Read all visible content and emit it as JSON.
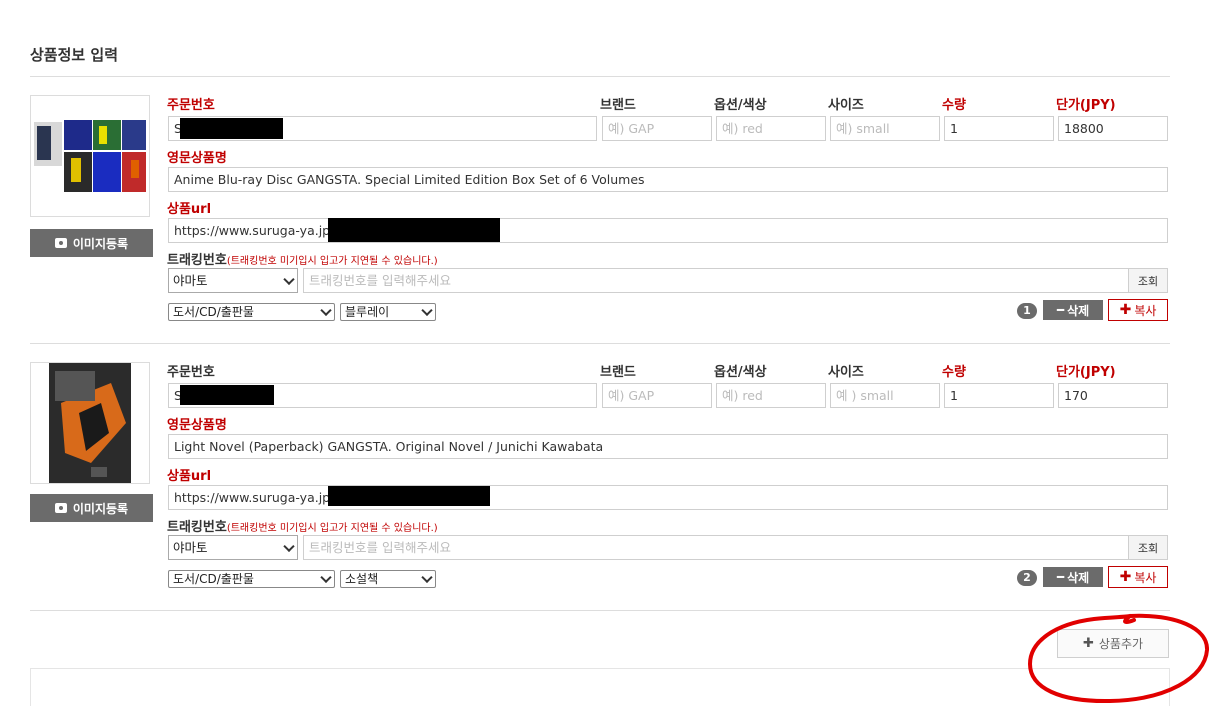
{
  "page": {
    "title": "상품정보 입력",
    "add_button": "상품추가",
    "colors": {
      "required_red": "#c00000",
      "button_gray": "#6b6b6b",
      "annotation_red": "#e10000"
    }
  },
  "labels": {
    "order_no": "주문번호",
    "brand": "브랜드",
    "option_color": "옵션/색상",
    "size": "사이즈",
    "qty": "수량",
    "unit_price": "단가(JPY)",
    "eng_name": "영문상품명",
    "url": "상품url",
    "tracking": "트래킹번호",
    "tracking_note": "(트래킹번호 미기입시 입고가 지연될 수 있습니다.)",
    "image_register": "이미지등록",
    "lookup": "조회",
    "delete": "삭제",
    "copy": "복사"
  },
  "items": [
    {
      "index": "1",
      "order_no": "S",
      "brand_placeholder": "예) GAP",
      "color_placeholder": "예) red",
      "size_placeholder": "예) small",
      "qty": "1",
      "unit_price": "18800",
      "eng_name": "Anime Blu-ray Disc GANGSTA. Special Limited Edition Box Set of 6 Volumes",
      "url": "https://www.suruga-ya.jp",
      "carrier": "야마토",
      "tracking_placeholder": "트래킹번호를 입력해주세요",
      "category": "도서/CD/출판물",
      "subcategory": "블루레이"
    },
    {
      "index": "2",
      "order_no": "S",
      "brand_placeholder": "예) GAP",
      "color_placeholder": "예) red",
      "size_placeholder": "예 ) small",
      "qty": "1",
      "unit_price": "170",
      "eng_name": "Light Novel (Paperback) GANGSTA. Original Novel / Junichi Kawabata",
      "url": "https://www.suruga-ya.jp",
      "carrier": "야마토",
      "tracking_placeholder": "트래킹번호를 입력해주세요",
      "category": "도서/CD/출판물",
      "subcategory": "소설책"
    }
  ]
}
